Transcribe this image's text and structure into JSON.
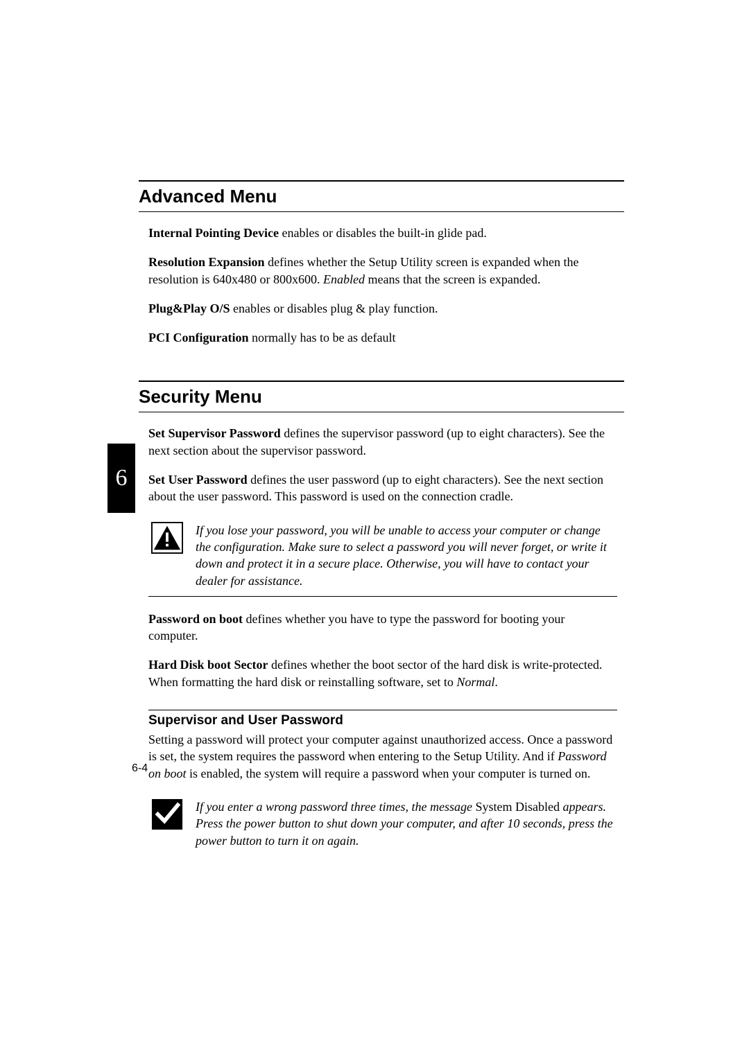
{
  "sideTab": "6",
  "pageNumber": "6-4",
  "advanced": {
    "heading": "Advanced Menu",
    "p1_b": "Internal Pointing Device",
    "p1_r": " enables or disables the built-in glide pad.",
    "p2_b": "Resolution Expansion",
    "p2_r1": " defines whether the Setup Utility screen is expanded when the resolution is 640x480 or 800x600. ",
    "p2_i": "Enabled",
    "p2_r2": " means that the screen is expanded.",
    "p3_b": "Plug&Play O/S",
    "p3_r": " enables or disables plug & play function.",
    "p4_b": "PCI Configuration",
    "p4_r": " normally has to be as default"
  },
  "security": {
    "heading": "Security Menu",
    "p1_b": "Set Supervisor Password",
    "p1_r": " defines the supervisor password (up to eight characters). See the next section about the supervisor password.",
    "p2_b": "Set User Password",
    "p2_r": " defines the user password (up to eight characters). See the next section about the user password.  This password is used on the connection cradle.",
    "warn": "If you lose your password, you will be unable to access your computer or change the configuration. Make sure to select a password you will never forget, or write it down and protect it in a secure place. Otherwise, you will have to contact your dealer for assistance.",
    "p3_b": "Password on boot",
    "p3_r": " defines whether you have to type the password for booting your computer.",
    "p4_b": "Hard Disk boot Sector",
    "p4_r1": " defines whether the boot sector of the hard disk is write-protected. When formatting the hard disk or reinstalling software, set to ",
    "p4_i": "Normal",
    "p4_r2": ".",
    "subhead": "Supervisor and User Password",
    "sub_r1": "Setting a password will protect your computer against unauthorized access. Once a password is set, the system requires the password when entering to the Setup Utility. And if ",
    "sub_i": "Password on boot",
    "sub_r2": " is enabled, the system will require a password when your computer is turned on.",
    "note_i1": "If you enter a wrong password three times, the message ",
    "note_up": "System Disabled",
    "note_i2": " appears. Press the power button to shut down your computer, and after 10 seconds, press the power button to turn it on again."
  }
}
